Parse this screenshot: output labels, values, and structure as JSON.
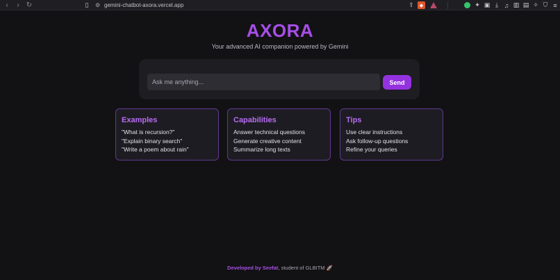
{
  "browser": {
    "url": "gemini-chatbot-axora.vercel.app"
  },
  "header": {
    "title": "AXORA",
    "subtitle": "Your advanced AI companion powered by Gemini"
  },
  "chat": {
    "placeholder": "Ask me anything...",
    "send_label": "Send"
  },
  "cards": [
    {
      "title": "Examples",
      "items": [
        "\"What is recursion?\"",
        "\"Explain binary search\"",
        "\"Write a poem about rain\""
      ]
    },
    {
      "title": "Capabilities",
      "items": [
        "Answer technical questions",
        "Generate creative content",
        "Summarize long texts"
      ]
    },
    {
      "title": "Tips",
      "items": [
        "Use clear instructions",
        "Ask follow-up questions",
        "Refine your queries"
      ]
    }
  ],
  "footer": {
    "developed_by": "Developed by Seefat",
    "rest": ", student of GLBITM ",
    "emoji": "🚀"
  },
  "colors": {
    "accent": "#a64ee6",
    "send_button": "#9432e0",
    "background": "#121114"
  }
}
